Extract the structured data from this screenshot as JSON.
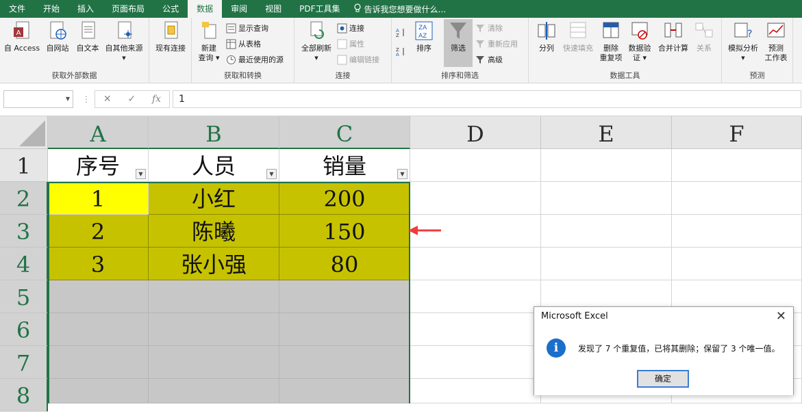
{
  "menu": {
    "tabs": [
      "文件",
      "开始",
      "插入",
      "页面布局",
      "公式",
      "数据",
      "审阅",
      "视图",
      "PDF工具集"
    ],
    "active_index": 5,
    "tell_me": "告诉我您想要做什么..."
  },
  "ribbon": {
    "groups": {
      "external": "获取外部数据",
      "transform": "获取和转换",
      "connections": "连接",
      "sort_filter": "排序和筛选",
      "data_tools": "数据工具",
      "forecast": "预测"
    },
    "buttons": {
      "access": "自 Access",
      "web": "自网站",
      "text": "自文本",
      "other": "自其他来源",
      "existing": "现有连接",
      "new_query_1": "新建",
      "new_query_2": "查询",
      "show_queries": "显示查询",
      "from_table": "从表格",
      "recent_sources": "最近使用的源",
      "refresh_all": "全部刷新",
      "connections": "连接",
      "properties": "属性",
      "edit_links": "编辑链接",
      "sort": "排序",
      "filter": "筛选",
      "clear": "清除",
      "reapply": "重新应用",
      "advanced": "高级",
      "split": "分列",
      "flash_fill": "快速填充",
      "remove_dup_1": "删除",
      "remove_dup_2": "重复项",
      "validation_1": "数据验",
      "validation_2": "证",
      "consolidate": "合并计算",
      "relationships": "关系",
      "whatif": "模拟分析",
      "forecast_1": "预测",
      "forecast_2": "工作表"
    }
  },
  "formula_bar": {
    "name_box": "",
    "value": "1"
  },
  "sheet": {
    "columns": [
      "A",
      "B",
      "C",
      "D",
      "E",
      "F"
    ],
    "rows": [
      "1",
      "2",
      "3",
      "4",
      "5",
      "6",
      "7",
      "8"
    ],
    "headers": [
      "序号",
      "人员",
      "销量"
    ],
    "data": [
      [
        "1",
        "小红",
        "200"
      ],
      [
        "2",
        "陈曦",
        "150"
      ],
      [
        "3",
        "张小强",
        "80"
      ]
    ],
    "colors": {
      "highlight": "#c6c200",
      "active": "#ffff00",
      "selection_border": "#217346"
    }
  },
  "dialog": {
    "title": "Microsoft Excel",
    "message": "发现了 7 个重复值，已将其删除；保留了 3 个唯一值。",
    "ok": "确定",
    "icon": "info-icon"
  }
}
